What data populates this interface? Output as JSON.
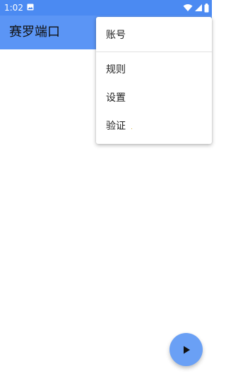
{
  "status_bar": {
    "time": "1:02",
    "icons": [
      "gallery-icon",
      "wifi-icon",
      "signal-icon",
      "battery-icon"
    ]
  },
  "app_bar": {
    "title": "赛罗端口",
    "color": "#5b95f5"
  },
  "menu": {
    "items": [
      {
        "label": "账号"
      },
      {
        "label": "规则"
      },
      {
        "label": "设置"
      },
      {
        "label": "验证"
      }
    ]
  },
  "fab": {
    "icon": "play-icon",
    "color": "#6aa0f5"
  }
}
